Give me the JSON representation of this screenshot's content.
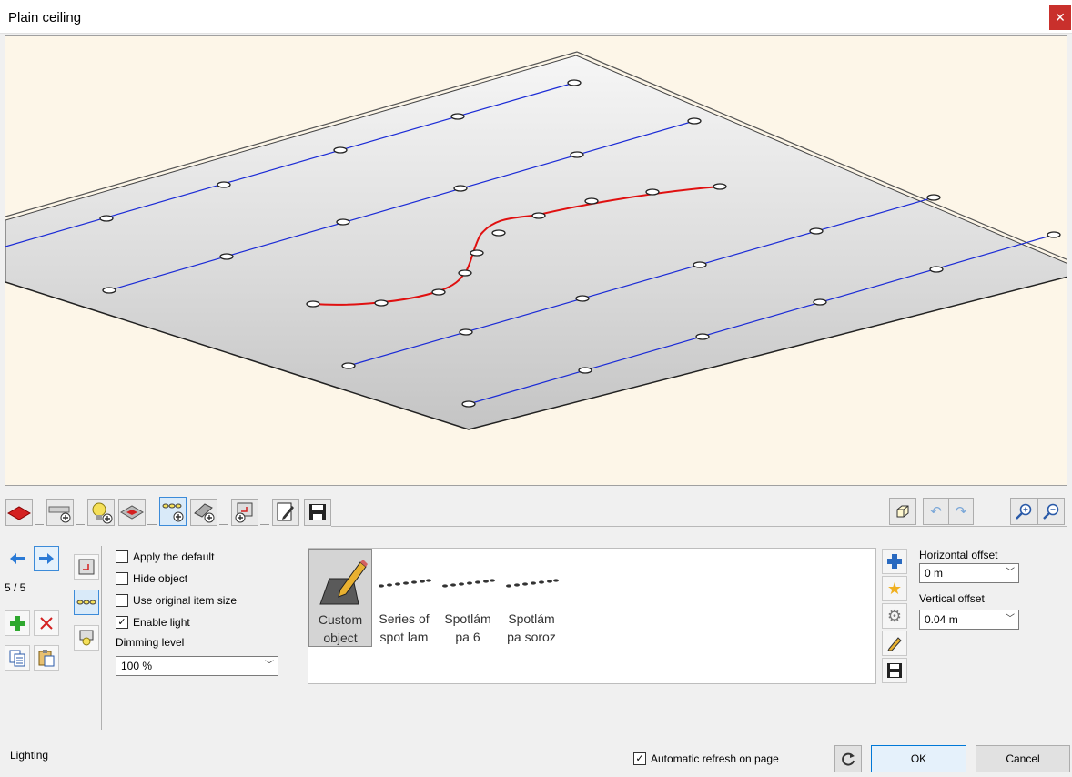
{
  "window": {
    "title": "Plain ceiling",
    "close_glyph": "✕"
  },
  "toolbar": {
    "tools": [
      {
        "name": "ceiling-shape-tool",
        "icon": "red-slab-icon"
      },
      {
        "name": "ceiling-profile-tool",
        "icon": "profile-add-icon"
      },
      {
        "name": "light-add-tool",
        "icon": "bulb-add-icon"
      },
      {
        "name": "ceiling-grid-tool",
        "icon": "grid-slab-icon"
      },
      {
        "name": "lighting-series-tool",
        "icon": "spot-series-add-icon",
        "selected": true
      },
      {
        "name": "element-add-tool",
        "icon": "panel-add-icon"
      },
      {
        "name": "opening-add-tool",
        "icon": "opening-add-icon"
      },
      {
        "name": "edit-doc-tool",
        "icon": "edit-document-icon"
      },
      {
        "name": "save-tool",
        "icon": "save-icon"
      }
    ],
    "right_tools": [
      "view-3d-icon",
      "undo-icon",
      "redo-icon",
      "zoom-in-icon",
      "zoom-out-icon"
    ]
  },
  "nav": {
    "counter": "5 / 5"
  },
  "options": {
    "apply_default": {
      "label": "Apply the default",
      "checked": false
    },
    "hide_object": {
      "label": "Hide object",
      "checked": false
    },
    "use_original_size": {
      "label": "Use original item size",
      "checked": false
    },
    "enable_light": {
      "label": "Enable light",
      "checked": true
    },
    "dimming_label": "Dimming level",
    "dimming_value": "100 %"
  },
  "library": {
    "items": [
      {
        "line1": "Custom",
        "line2": "object",
        "selected": true
      },
      {
        "line1": "Series of",
        "line2": "spot lam",
        "selected": false
      },
      {
        "line1": "Spotlám",
        "line2": "pa 6",
        "selected": false
      },
      {
        "line1": "Spotlám",
        "line2": "pa soroz",
        "selected": false
      }
    ]
  },
  "offsets": {
    "horizontal_label": "Horizontal offset",
    "horizontal_value": "0 m",
    "vertical_label": "Vertical offset",
    "vertical_value": "0.04 m"
  },
  "footer": {
    "section": "Lighting",
    "auto_refresh": {
      "label": "Automatic refresh on page",
      "checked": true
    },
    "ok": "OK",
    "cancel": "Cancel"
  },
  "colors": {
    "line_blue": "#1b2bd6",
    "curve_red": "#e01010",
    "close_red": "#c9302c",
    "viewport_bg": "#fdf6e8"
  }
}
